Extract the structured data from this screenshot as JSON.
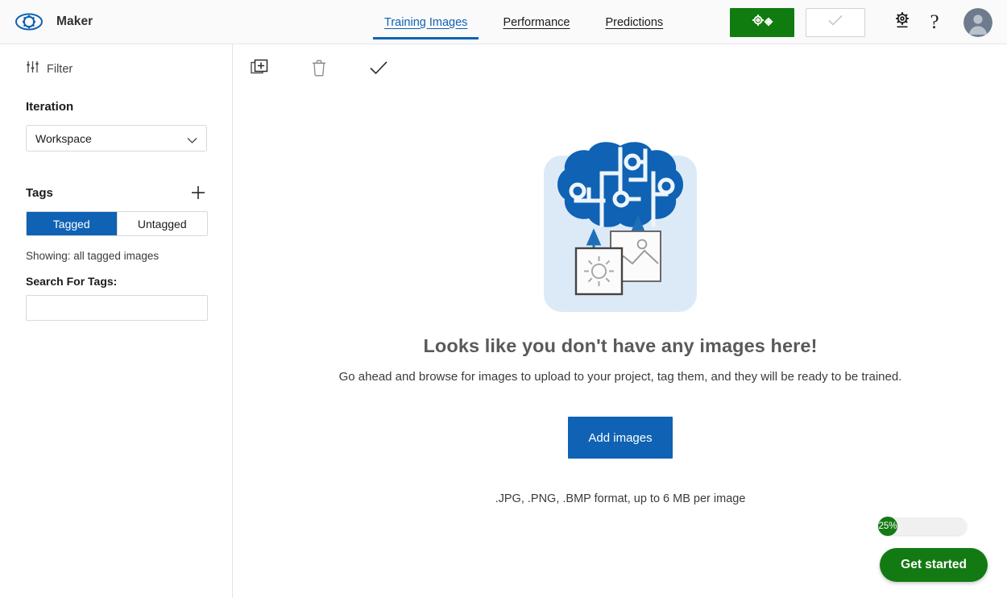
{
  "header": {
    "brand_title": "Maker",
    "logo_icon": "eye-gear-logo",
    "nav": [
      {
        "label": "Training Images",
        "active": true
      },
      {
        "label": "Performance",
        "active": false
      },
      {
        "label": "Predictions",
        "active": false
      }
    ],
    "train_button": {
      "icon": "double-gear-icon",
      "label": ""
    },
    "check_button": {
      "icon": "check-icon",
      "label": "",
      "disabled": true
    },
    "settings_icon": "gear-icon",
    "help_icon": "question-mark-icon",
    "avatar_icon": "user-avatar"
  },
  "sidebar": {
    "filter": {
      "label": "Filter",
      "icon": "sliders-filter-icon"
    },
    "iteration": {
      "title": "Iteration",
      "selected": "Workspace",
      "chevron": "chevron-down-icon"
    },
    "tags": {
      "title": "Tags",
      "add_icon": "plus-icon",
      "toggle": [
        {
          "label": "Tagged",
          "selected": true
        },
        {
          "label": "Untagged",
          "selected": false
        }
      ],
      "showing": "Showing: all tagged images",
      "search_label": "Search For Tags:",
      "search_value": "",
      "search_placeholder": ""
    }
  },
  "toolbar": {
    "add_images_icon": "add-images-icon",
    "delete_icon": "trash-icon",
    "select_icon": "check-icon"
  },
  "main": {
    "illustration": "brain-upload-illustration",
    "title": "Looks like you don't have any images here!",
    "subtitle": "Go ahead and browse for images to upload to your project, tag them, and they will be ready to be trained.",
    "add_images_label": "Add images",
    "formats": ".JPG, .PNG, .BMP format, up to 6 MB per image"
  },
  "floating": {
    "progress_percent": "25%",
    "cta_label": "Get started"
  },
  "colors": {
    "accent_blue": "#0f62b4",
    "train_green": "#107c10",
    "cta_green": "#137a13",
    "illustration_blue": "#0f62b4",
    "illustration_bg": "#dceaf7"
  }
}
